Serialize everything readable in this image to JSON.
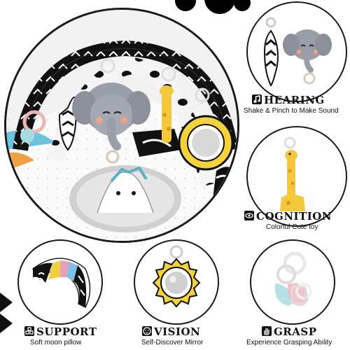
{
  "features": [
    {
      "title": "HEARING",
      "subtitle": "Shake & Pinch to Make Sound",
      "icon": "music-note-icon"
    },
    {
      "title": "COGNITION",
      "subtitle": "Colorful Cute toy",
      "icon": "eye-icon"
    },
    {
      "title": "SUPPORT",
      "subtitle": "Soft moon pillow",
      "icon": "blocks-icon"
    },
    {
      "title": "VISION",
      "subtitle": "Self-Discover Mirror",
      "icon": "baby-face-icon"
    },
    {
      "title": "GRASP",
      "subtitle": "Experience Grasping Ability",
      "icon": "hand-icon"
    }
  ],
  "colors": {
    "accent": "#f4d23c",
    "ink": "#111111",
    "elephant": "#9a9ea8"
  }
}
